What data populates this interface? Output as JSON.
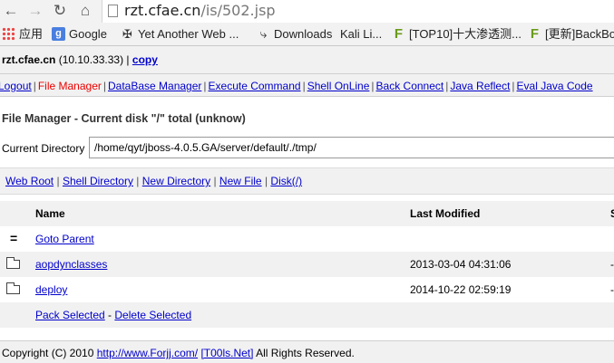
{
  "browser": {
    "url_host": "rzt.cfae.cn",
    "url_path": "/is/502.jsp",
    "bookmarks": [
      {
        "icon": "apps-icon",
        "label": "应用"
      },
      {
        "icon": "google-icon",
        "label": "Google"
      },
      {
        "icon": "pin-icon",
        "label": "Yet Another Web ..."
      },
      {
        "icon": "download-icon",
        "label": "Downloads"
      },
      {
        "icon": "",
        "label": "Kali Li..."
      },
      {
        "icon": "f-icon",
        "label": "[TOP10]十大渗透测..."
      },
      {
        "icon": "f-icon",
        "label": "[更新]BackBo"
      }
    ]
  },
  "host": {
    "name": "rzt.cfae.cn",
    "ip": "(10.10.33.33)",
    "copy_label": "copy"
  },
  "menu": [
    "Logout",
    "File Manager",
    "DataBase Manager",
    "Execute Command",
    "Shell OnLine",
    "Back Connect",
    "Java Reflect",
    "Eval Java Code"
  ],
  "fm": {
    "title": "File Manager - Current disk \"/\" total (unknow)",
    "current_dir_label": "Current Directory",
    "current_dir_value": "/home/qyt/jboss-4.0.5.GA/server/default/./tmp/",
    "links": [
      "Web Root",
      "Shell Directory",
      "New Directory",
      "New File",
      "Disk(/)"
    ]
  },
  "table": {
    "headers": {
      "name": "Name",
      "modified": "Last Modified",
      "size": "S"
    },
    "parent_label": "Goto Parent",
    "rows": [
      {
        "name": "aopdynclasses",
        "modified": "2013-03-04 04:31:06",
        "extra": "-"
      },
      {
        "name": "deploy",
        "modified": "2014-10-22 02:59:19",
        "extra": "-"
      }
    ],
    "pack_label": "Pack Selected",
    "delete_label": "Delete Selected"
  },
  "footer": {
    "copyright": "Copyright (C) 2010",
    "link1": "http://www.Forjj.com/",
    "link2": "[T00ls.Net]",
    "rights": "All Rights Reserved."
  }
}
